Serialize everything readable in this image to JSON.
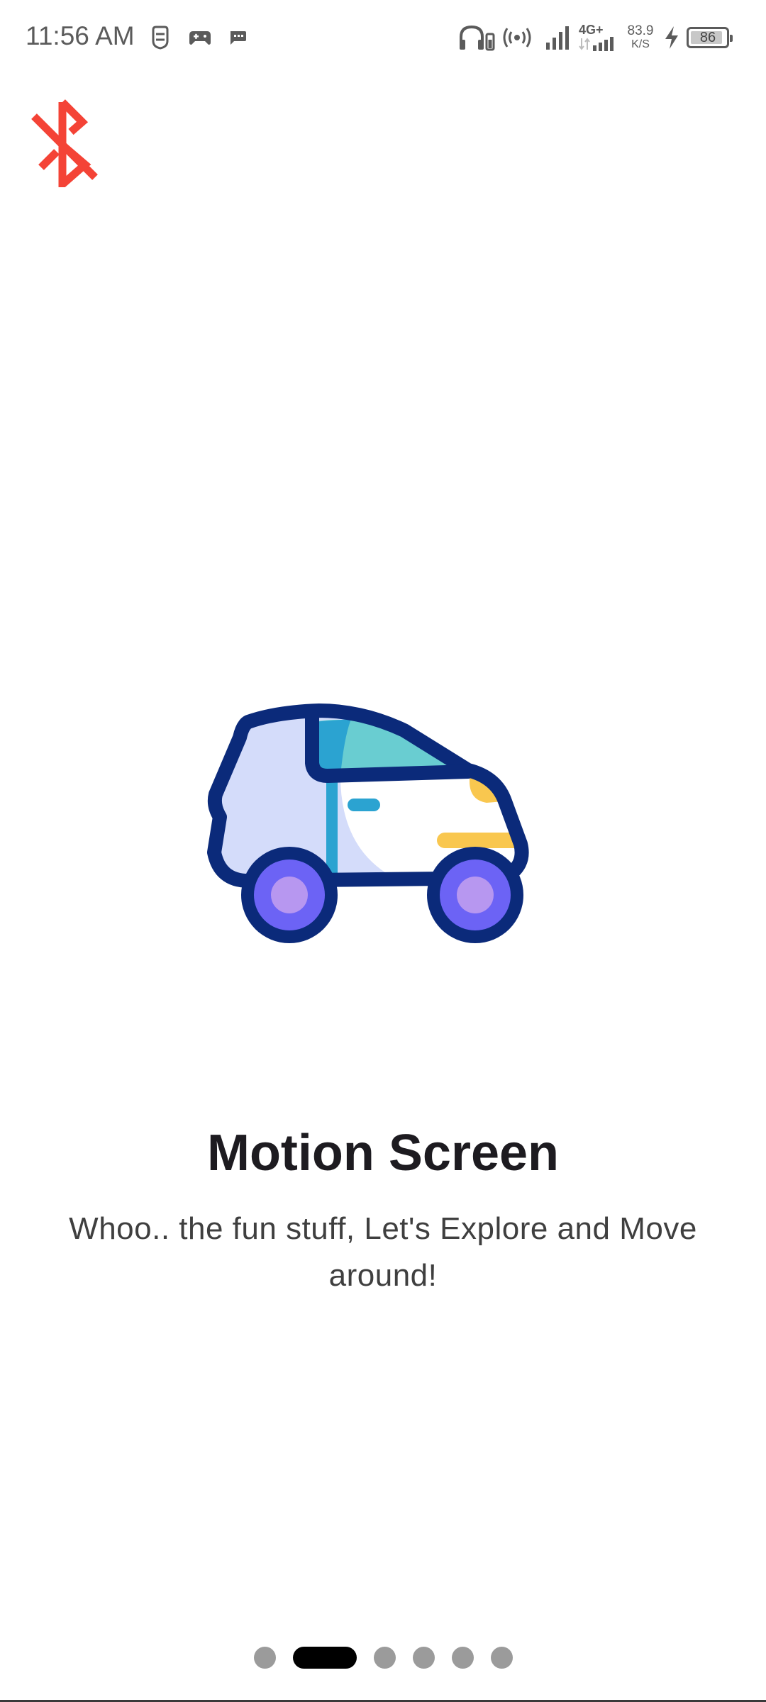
{
  "status_bar": {
    "time": "11:56 AM",
    "net_speed_value": "83.9",
    "net_speed_unit": "K/S",
    "network_type": "4G+",
    "battery_level": "86",
    "icons": [
      "notification-icon",
      "gamepad-icon",
      "message-icon",
      "headphones-icon",
      "hotspot-icon",
      "signal-icon",
      "signal-4g-icon",
      "charging-icon",
      "battery-icon"
    ]
  },
  "bluetooth_button": {
    "icon": "bluetooth-disabled-icon",
    "color": "#f44336"
  },
  "onboarding": {
    "illustration": "car-icon",
    "title": "Motion Screen",
    "subtitle": "Whoo.. the fun stuff, Let's Explore and Move around!"
  },
  "page_indicator": {
    "total_pages": 6,
    "active_index": 1,
    "active_color": "#000000",
    "inactive_color": "#9b9b9b"
  }
}
